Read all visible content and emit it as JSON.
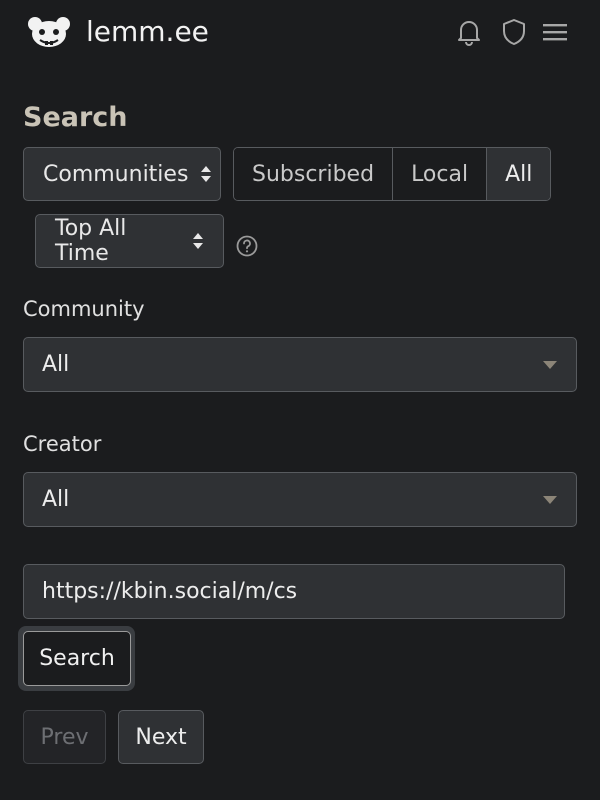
{
  "header": {
    "brand": "lemm.ee",
    "icons": [
      "bell-icon",
      "shield-icon",
      "menu-icon"
    ]
  },
  "page": {
    "title": "Search"
  },
  "filters": {
    "type_select": "Communities",
    "listing": [
      "Subscribed",
      "Local",
      "All"
    ],
    "listing_selected": "All",
    "sort_select": "Top All Time"
  },
  "community": {
    "label": "Community",
    "value": "All"
  },
  "creator": {
    "label": "Creator",
    "value": "All"
  },
  "search": {
    "query": "https://kbin.social/m/cs",
    "button": "Search"
  },
  "pagination": {
    "prev": "Prev",
    "next": "Next"
  },
  "colors": {
    "background": "#1b1c1e",
    "title": "#c9c3b6",
    "control_bg": "#2f3134",
    "border": "#585b5f"
  }
}
